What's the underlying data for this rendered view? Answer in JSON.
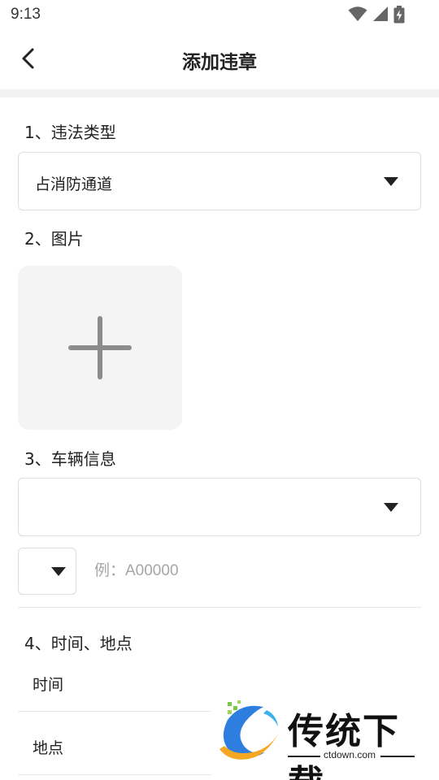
{
  "status_bar": {
    "time": "9:13",
    "icons": [
      "wifi-icon",
      "signal-icon",
      "battery-charging-icon"
    ]
  },
  "header": {
    "title": "添加违章",
    "back_icon": "chevron-left-icon"
  },
  "sections": {
    "violation_type": {
      "label": "1、违法类型",
      "selected": "占消防通道"
    },
    "images": {
      "label": "2、图片",
      "add_icon": "plus-icon"
    },
    "vehicle": {
      "label": "3、车辆信息",
      "selected": "",
      "plate_prefix": "",
      "plate_placeholder": "例：A00000"
    },
    "time_place": {
      "label": "4、时间、地点",
      "time_label": "时间",
      "place_label": "地点"
    }
  },
  "watermark": {
    "name": "传统下载",
    "domain": "ctdown.com"
  },
  "colors": {
    "text": "#222222",
    "placeholder": "#a6a6a6",
    "border": "#dddddd",
    "tile_bg": "#f4f4f4",
    "band": "#f2f2f2"
  }
}
